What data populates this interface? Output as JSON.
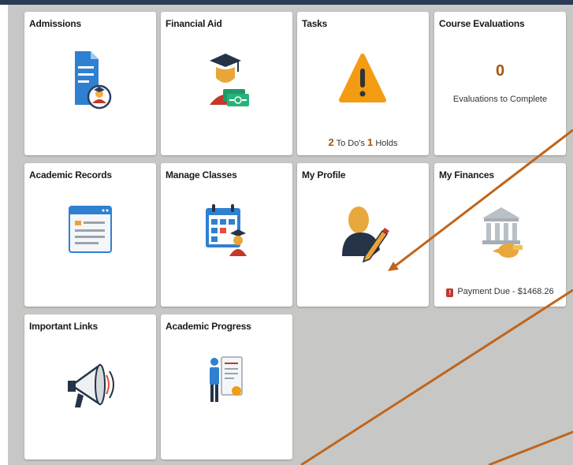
{
  "tiles": [
    {
      "id": "admissions",
      "title": "Admissions",
      "icon": "admissions-document-icon"
    },
    {
      "id": "financial-aid",
      "title": "Financial Aid",
      "icon": "graduate-money-icon"
    },
    {
      "id": "tasks",
      "title": "Tasks",
      "icon": "warning-triangle-icon",
      "todo_count": "2",
      "todo_label": "To Do's",
      "holds_count": "1",
      "holds_label": "Holds"
    },
    {
      "id": "course-evaluations",
      "title": "Course Evaluations",
      "count": "0",
      "label": "Evaluations to Complete"
    },
    {
      "id": "academic-records",
      "title": "Academic Records",
      "icon": "browser-records-icon"
    },
    {
      "id": "manage-classes",
      "title": "Manage Classes",
      "icon": "calendar-student-icon"
    },
    {
      "id": "my-profile",
      "title": "My Profile",
      "icon": "person-pencil-icon"
    },
    {
      "id": "my-finances",
      "title": "My Finances",
      "icon": "bank-moneybag-icon",
      "alert_icon": "alert-badge-icon",
      "alert_glyph": "!",
      "payment_text": "Payment Due - $1468.26"
    },
    {
      "id": "important-links",
      "title": "Important Links",
      "icon": "megaphone-icon"
    },
    {
      "id": "academic-progress",
      "title": "Academic Progress",
      "icon": "person-certificate-icon"
    }
  ],
  "colors": {
    "board": "#c7c8c6",
    "accent": "#a4570b",
    "arrow": "#c0651c",
    "alert": "#c0392b"
  }
}
